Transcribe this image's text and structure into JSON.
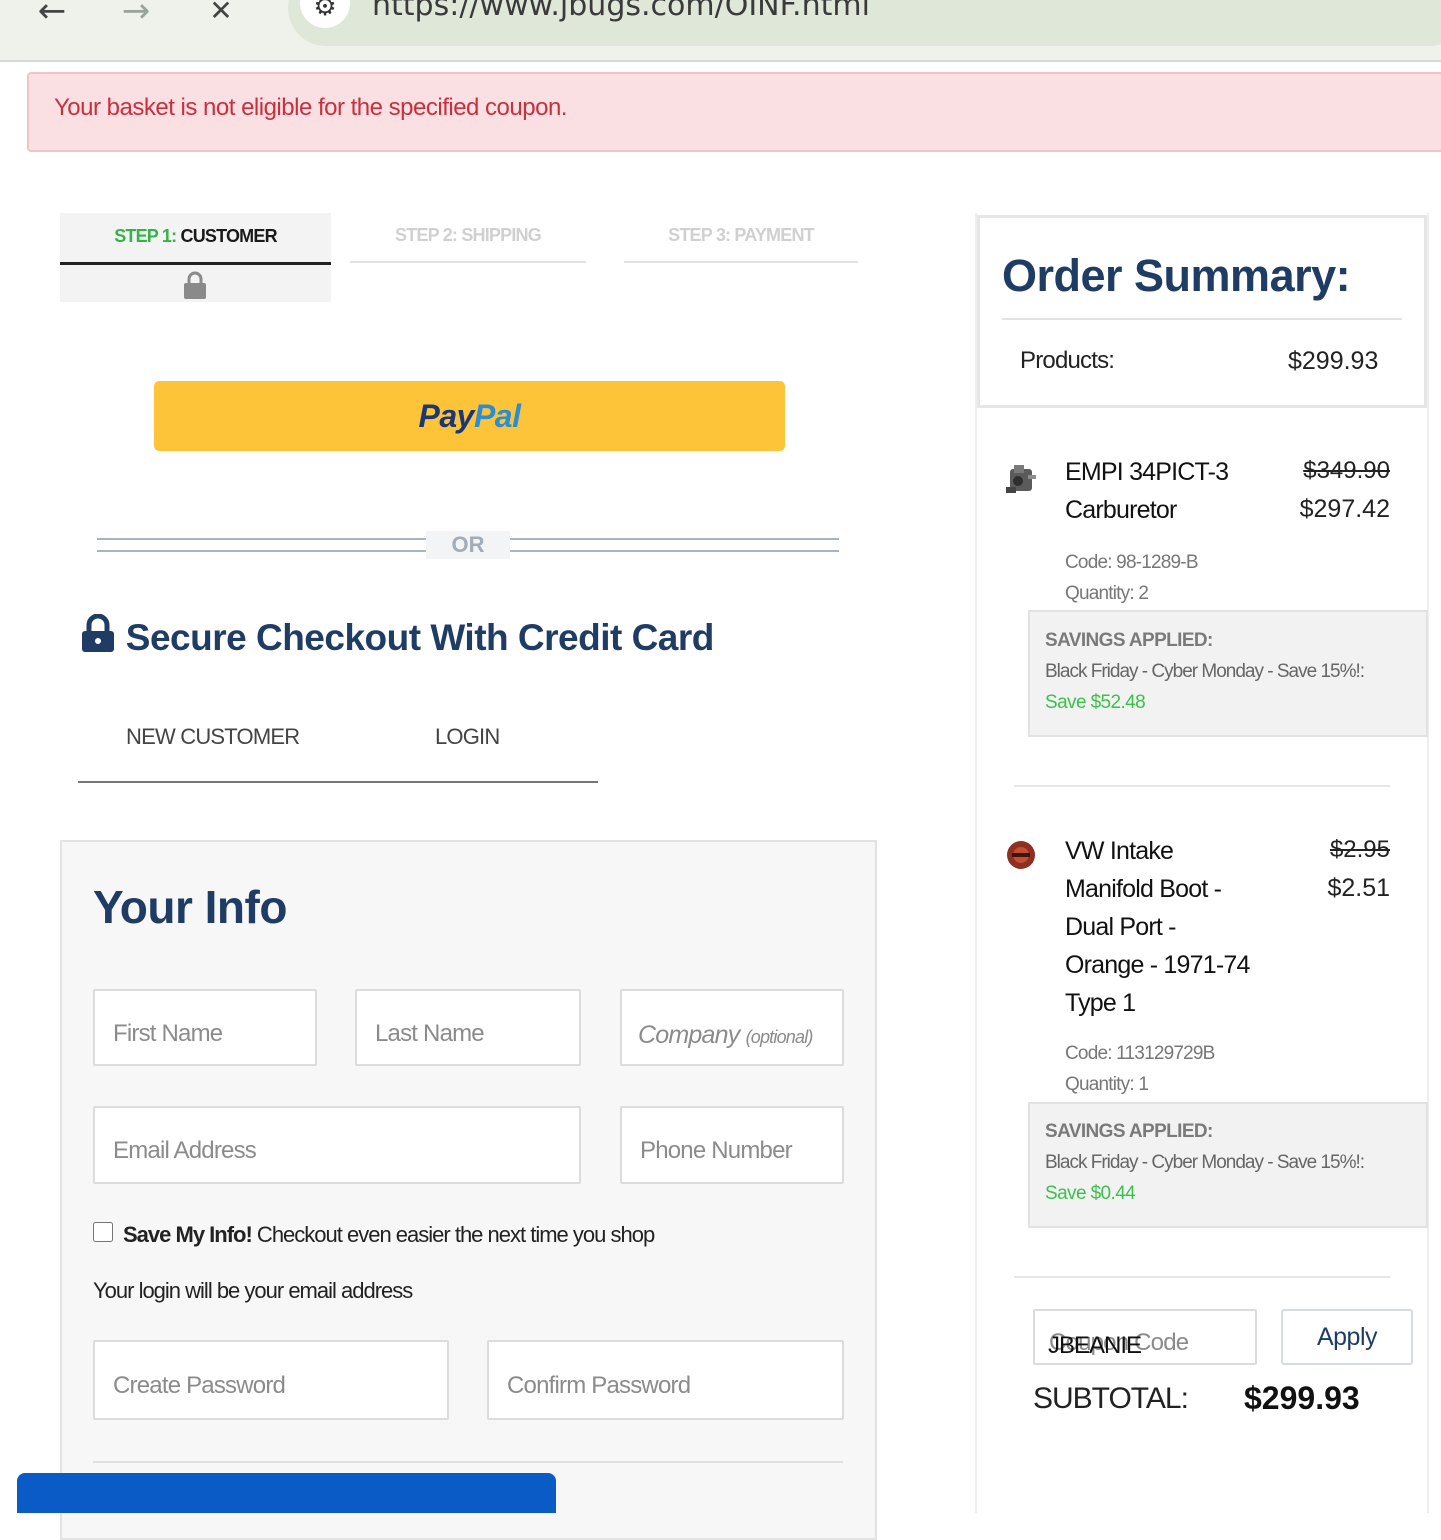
{
  "browser": {
    "back_icon": "←",
    "forward_icon": "→",
    "stop_icon": "✕",
    "site_info_icon": "⚙",
    "url": "https://www.jbugs.com/OINF.html"
  },
  "alert": {
    "message": "Your basket is not eligible for the specified coupon."
  },
  "steps": {
    "step1_prefix": "STEP 1:",
    "step1_label": "CUSTOMER",
    "step2": "STEP 2: SHIPPING",
    "step3": "STEP 3: PAYMENT",
    "lock_icon": "🔒"
  },
  "paypal": {
    "pay": "Pay",
    "pal": "Pal"
  },
  "divider": {
    "or": "OR"
  },
  "secure_checkout": {
    "lock_icon": "🔒",
    "title": "Secure Checkout With Credit Card"
  },
  "customer_tabs": {
    "new_customer": "NEW CUSTOMER",
    "login": "LOGIN"
  },
  "your_info": {
    "title": "Your Info",
    "first_name_placeholder": "First Name",
    "last_name_placeholder": "Last Name",
    "company_placeholder": "Company",
    "company_optional": "(optional)",
    "email_placeholder": "Email Address",
    "phone_placeholder": "Phone Number",
    "save_info_bold": "Save My Info!",
    "save_info_text": " Checkout even easier the next time you shop",
    "login_note": "Your login will be your email address",
    "create_password_placeholder": "Create Password",
    "confirm_password_placeholder": "Confirm Password"
  },
  "order_summary": {
    "title": "Order Summary:",
    "products_label": "Products:",
    "products_value": "$299.93",
    "items": [
      {
        "icon": "carburetor-thumbnail",
        "name": "EMPI 34PICT-3 Carburetor",
        "old_price": "$349.90",
        "new_price": "$297.42",
        "code": "Code: 98-1289-B",
        "quantity": "Quantity: 2",
        "savings_heading": "SAVINGS APPLIED:",
        "savings_desc": "Black Friday - Cyber Monday - Save 15%!:",
        "savings_amount": "Save $52.48"
      },
      {
        "icon": "intake-boot-thumbnail",
        "name": "VW Intake Manifold Boot - Dual Port - Orange - 1971-74 Type 1",
        "old_price": "$2.95",
        "new_price": "$2.51",
        "code": "Code: 113129729B",
        "quantity": "Quantity: 1",
        "savings_heading": "SAVINGS APPLIED:",
        "savings_desc": "Black Friday - Cyber Monday - Save 15%!:",
        "savings_amount": "Save $0.44"
      }
    ],
    "coupon_placeholder": "Coupon Code",
    "coupon_value": "JBEANIE",
    "apply_label": "Apply",
    "subtotal_label": "SUBTOTAL:",
    "subtotal_value": "$299.93"
  },
  "colors": {
    "brand_navy": "#1f3d64",
    "step_green": "#36b24a",
    "paypal_yellow": "#fdc439",
    "alert_red": "#c9303e",
    "savings_green": "#3cc04c"
  }
}
